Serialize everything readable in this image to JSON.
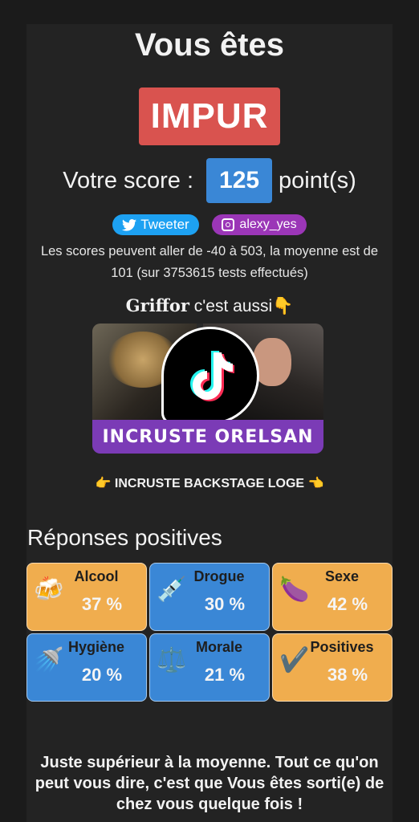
{
  "header": {
    "title": "Vous êtes"
  },
  "result": {
    "label": "IMPUR",
    "color": "#d9534f"
  },
  "score": {
    "prefix": "Votre score :",
    "value": "125",
    "suffix": "point(s)"
  },
  "social": {
    "twitter_label": "Tweeter",
    "instagram_label": "alexy_yes"
  },
  "stats_note": "Les scores peuvent aller de -40 à 503, la moyenne est de 101 (sur 3753615 tests effectués)",
  "promo": {
    "brand": "Griffor",
    "tagline": " c'est aussi👇",
    "banner": "INCRUSTE ORELSAN",
    "link": "👉 INCRUSTE BACKSTAGE LOGE 👈"
  },
  "section_title": "Réponses positives",
  "categories": [
    {
      "name": "Alcool",
      "percent": "37 %",
      "icon": "beer-mugs-icon",
      "color": "#f0ad4e"
    },
    {
      "name": "Drogue",
      "percent": "30 %",
      "icon": "syringe-icon",
      "color": "#3a87d6"
    },
    {
      "name": "Sexe",
      "percent": "42 %",
      "icon": "eggplant-icon",
      "color": "#f0ad4e"
    },
    {
      "name": "Hygiène",
      "percent": "20 %",
      "icon": "shower-icon",
      "color": "#3a87d6"
    },
    {
      "name": "Morale",
      "percent": "21 %",
      "icon": "scales-icon",
      "color": "#3a87d6"
    },
    {
      "name": "Positives",
      "percent": "38 %",
      "icon": "check-mark-icon",
      "color": "#f0ad4e"
    }
  ],
  "verdict": "Juste supérieur à la moyenne. Tout ce qu'on peut vous dire, c'est que Vous êtes sorti(e) de chez vous quelque fois !"
}
